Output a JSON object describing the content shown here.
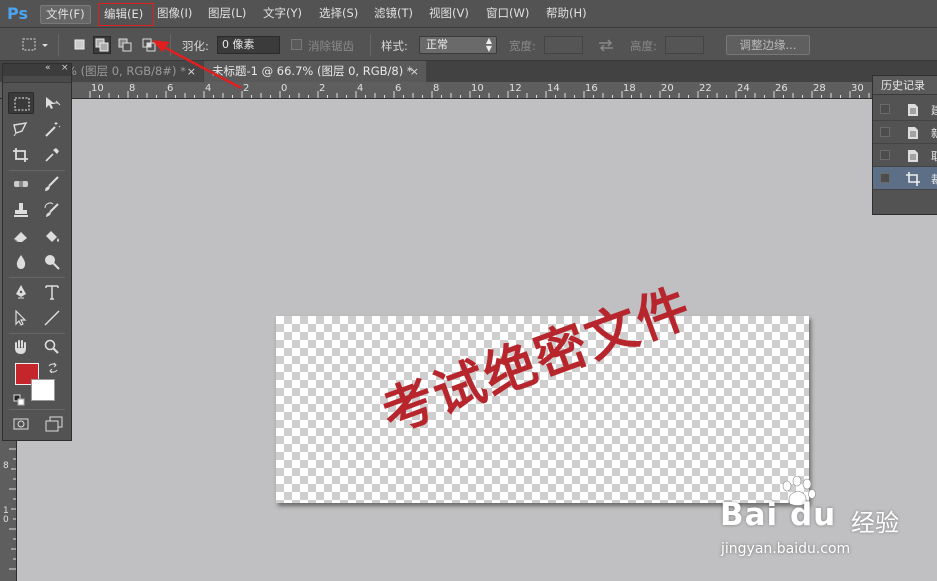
{
  "app": {
    "logo": "Ps"
  },
  "menu": {
    "items": [
      {
        "label": "文件(F)"
      },
      {
        "label": "编辑(E)"
      },
      {
        "label": "图像(I)"
      },
      {
        "label": "图层(L)"
      },
      {
        "label": "文字(Y)"
      },
      {
        "label": "选择(S)"
      },
      {
        "label": "滤镜(T)"
      },
      {
        "label": "视图(V)"
      },
      {
        "label": "窗口(W)"
      },
      {
        "label": "帮助(H)"
      }
    ]
  },
  "options": {
    "feather_label": "羽化:",
    "feather_value": "0 像素",
    "antialias_label": "消除锯齿",
    "style_label": "样式:",
    "style_value": "正常",
    "width_label": "宽度:",
    "height_label": "高度:",
    "refine_edge_label": "调整边缘..."
  },
  "tabs": [
    {
      "label": "% (图层 0, RGB/8#) *",
      "close": "×"
    },
    {
      "label": "未标题-1 @ 66.7% (图层 0, RGB/8) *",
      "close": "×"
    }
  ],
  "ruler_h": [
    "10",
    "8",
    "6",
    "4",
    "2",
    "0",
    "2",
    "4",
    "6",
    "8",
    "10",
    "12",
    "14",
    "16",
    "18",
    "20",
    "22",
    "24",
    "26",
    "28",
    "30"
  ],
  "ruler_v": [
    "8",
    "1\n0"
  ],
  "tools_panel": {
    "collapse": "«",
    "close": "×"
  },
  "history": {
    "title": "历史记录",
    "rows": [
      {
        "name": "建"
      },
      {
        "name": "新"
      },
      {
        "name": "取"
      },
      {
        "name": "裁"
      }
    ]
  },
  "canvas": {
    "stamp_text": "考试绝密文件"
  },
  "colors": {
    "foreground": "#c5262c",
    "background": "#ffffff",
    "accent": "#e02020"
  },
  "watermark": {
    "brand": "Bai du",
    "brand_cn": "经验",
    "url": "jingyan.baidu.com"
  }
}
